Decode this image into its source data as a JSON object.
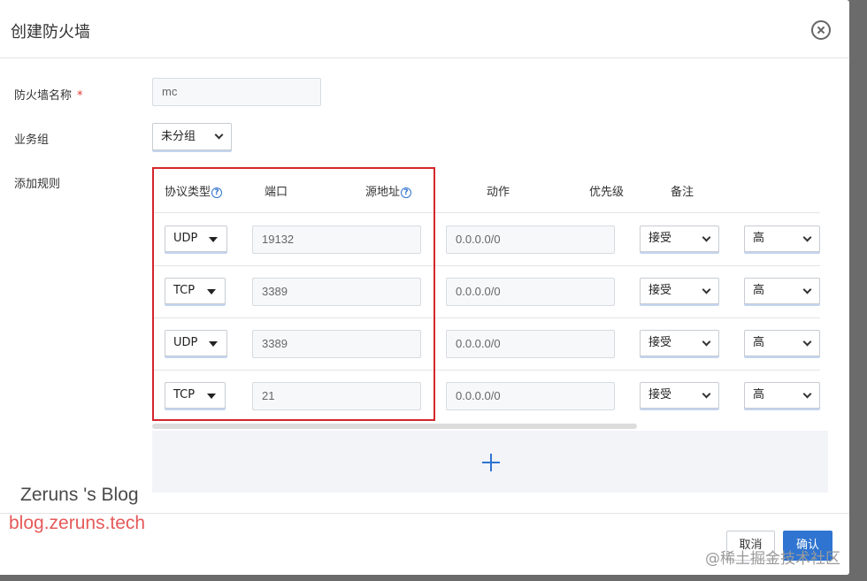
{
  "dialog": {
    "title": "创建防火墙"
  },
  "form": {
    "name_label": "防火墙名称",
    "required_mark": "*",
    "name_value": "mc",
    "group_label": "业务组",
    "group_value": "未分组",
    "rules_label": "添加规则"
  },
  "rules_table": {
    "headers": {
      "protocol": "协议类型",
      "port": "端口",
      "source": "源地址",
      "action": "动作",
      "priority": "优先级",
      "remark": "备注"
    },
    "help_glyph": "?",
    "rows": [
      {
        "protocol": "UDP",
        "port": "19132",
        "source": "0.0.0.0/0",
        "action": "接受",
        "priority": "高"
      },
      {
        "protocol": "TCP",
        "port": "3389",
        "source": "0.0.0.0/0",
        "action": "接受",
        "priority": "高"
      },
      {
        "protocol": "UDP",
        "port": "3389",
        "source": "0.0.0.0/0",
        "action": "接受",
        "priority": "高"
      },
      {
        "protocol": "TCP",
        "port": "21",
        "source": "0.0.0.0/0",
        "action": "接受",
        "priority": "高"
      }
    ],
    "add_rule_glyph": "+"
  },
  "footer": {
    "cancel_label": "取消",
    "confirm_label": "确认"
  },
  "watermarks": {
    "blog_name": "Zeruns 's Blog",
    "blog_url": "blog.zeruns.tech",
    "community": "@稀土掘金技术社区"
  },
  "colors": {
    "accent": "#2f74d0",
    "highlight_box": "#d4262a",
    "required": "#e3382e"
  },
  "icons": {
    "close": "close-circle-icon",
    "help": "question-circle-icon",
    "dropdown_chevron": "chevron-down-icon",
    "dropdown_caret": "caret-down-icon",
    "add": "plus-icon"
  }
}
